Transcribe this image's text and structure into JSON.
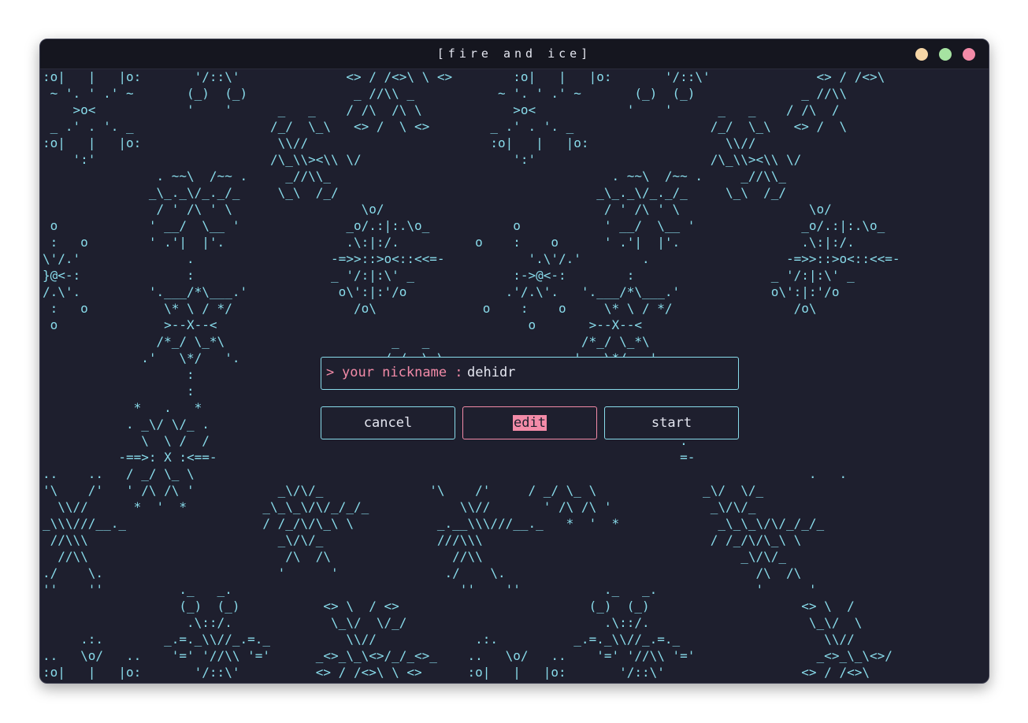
{
  "window": {
    "title": "[fire and ice]",
    "controls": {
      "minimize_color": "#f6d6a6",
      "maximize_color": "#a6e3a1",
      "close_color": "#f38ba8"
    }
  },
  "form": {
    "prompt_symbol": ">",
    "nickname_label": "your nickname :",
    "nickname_value": "dehidr"
  },
  "buttons": {
    "cancel": "cancel",
    "edit": "edit",
    "start": "start"
  },
  "background_art": ":o|   |   |o:       '/::\\'              <> / /<>\\ \\ <>        :o|   |   |o:       '/::\\'              <> / /<>\\\n ~ '. ' .' ~       (_)  (_)              _ //\\\\ _           ~ '. ' .' ~       (_)  (_)              _ //\\\\\n    >o<            '    '      _   _    / /\\  /\\ \\            >o<            '    '      _   _    / /\\  /\n _ .' . '. _                  /_/  \\_\\   <> /  \\ <>        _ .' . '. _                  /_/  \\_\\   <> /  \\\n:o|   |   |o:                  \\\\//                        :o|   |   |o:                  \\\\//\n    ':'                       /\\_\\\\><\\\\ \\/                    ':'                       /\\_\\\\><\\\\ \\/\n               . ~~\\  /~~ .     _//\\\\_                                     . ~~\\  /~~ .     _//\\\\_\n              _\\_._\\/_._/_     \\_\\  /_/                                  _\\_._\\/_._/_     \\_\\  /_/\n               / ' /\\ ' \\                 \\o/                             / ' /\\ ' \\                 \\o/\n o            ' __/  \\__ '              _o/.:|:.\\o_           o           ' __/  \\__ '              _o/.:|:.\\o_\n :   o        ' .'|  |'.                .\\:|:/.          o    :    o      ' .'|  |'.                .\\:|:/.\n\\'/.'              .                  -=>>::>o<::<<=-           '.\\'/.'        .                  -=>>::>o<::<<=-\n}@<-:              :                  _ '/:|:\\' _             :->@<-:        :                  _ '/:|:\\' _\n/.\\'.         '.___/*\\___.'            o\\':|:'/o             .'/.\\'.   '.___/*\\___.'            o\\':|:'/o\n :   o          \\* \\ / */                /o\\              o    :    o     \\* \\ / */                /o\\\n o              >--X--<                                         o       >--X--<\n               /*_/ \\_*\\                      _   _                    /*_/ \\_*\\\n             .'   \\*/   '.                   /_/  \\_\\                .'   \\*/   '.\n                   :\n                   :\n            *   .   *\n           . _\\/ \\/_ .\n             \\  \\ /  /                                                              .\n          -==>: X :<==-                                                             =-\n..    ..   / _/ \\_ \\                                                                                 .   .\n'\\    /'   ' /\\ /\\ '           _\\/\\/_              '\\    /'     / _/ \\_ \\              _\\/  \\/_\n  \\\\//      *  '  *          _\\_\\_\\/\\/_/_/_            \\\\//       ' /\\ /\\ '             _\\/\\/_\n_\\\\\\///__._                  / /_/\\/\\_\\ \\           _.__\\\\\\///__._   *  '  *             _\\_\\_\\/\\/_/_/_\n //\\\\\\                         _\\/\\/_               ///\\\\\\                              / /_/\\/\\_\\ \\\n  //\\\\                          /\\  /\\                //\\\\                                  _\\/\\/_\n./    \\.                       '      '              ./    \\.                                 /\\  /\\\n''    ''          ._   _.                              ''    ''           ._   _.             '      '\n                  (_)  (_)           <> \\  / <>                         (_)  (_)                    <> \\  /\n                   .\\::/.             \\_\\/  \\/_/                          .\\::/.                     \\_\\/  \\\n     .:.        _.=._\\\\//_.=._          \\\\//             .:.          _.=._\\\\//_.=._                   \\\\//\n..   \\o/   ..    '=' '//\\\\ '='      _<>_\\_\\<>/_/_<>_    ..   \\o/   ..    '=' '//\\\\ '='                _<>_\\_\\<>/\n:o|   |   |o:       '/::\\'          <> / /<>\\ \\ <>      :o|   |   |o:       '/::\\'                  <> / /<>\\\n ~ '. ' .' ~       (_)  (_)              _ //\\\\ _           ~ '. ' .' ~       (_)  (_)              _ //\\\\\n    >o<            '    '      _   _    / /\\  /\\ \\            >o<            '    '      _   _    / /\\  /"
}
